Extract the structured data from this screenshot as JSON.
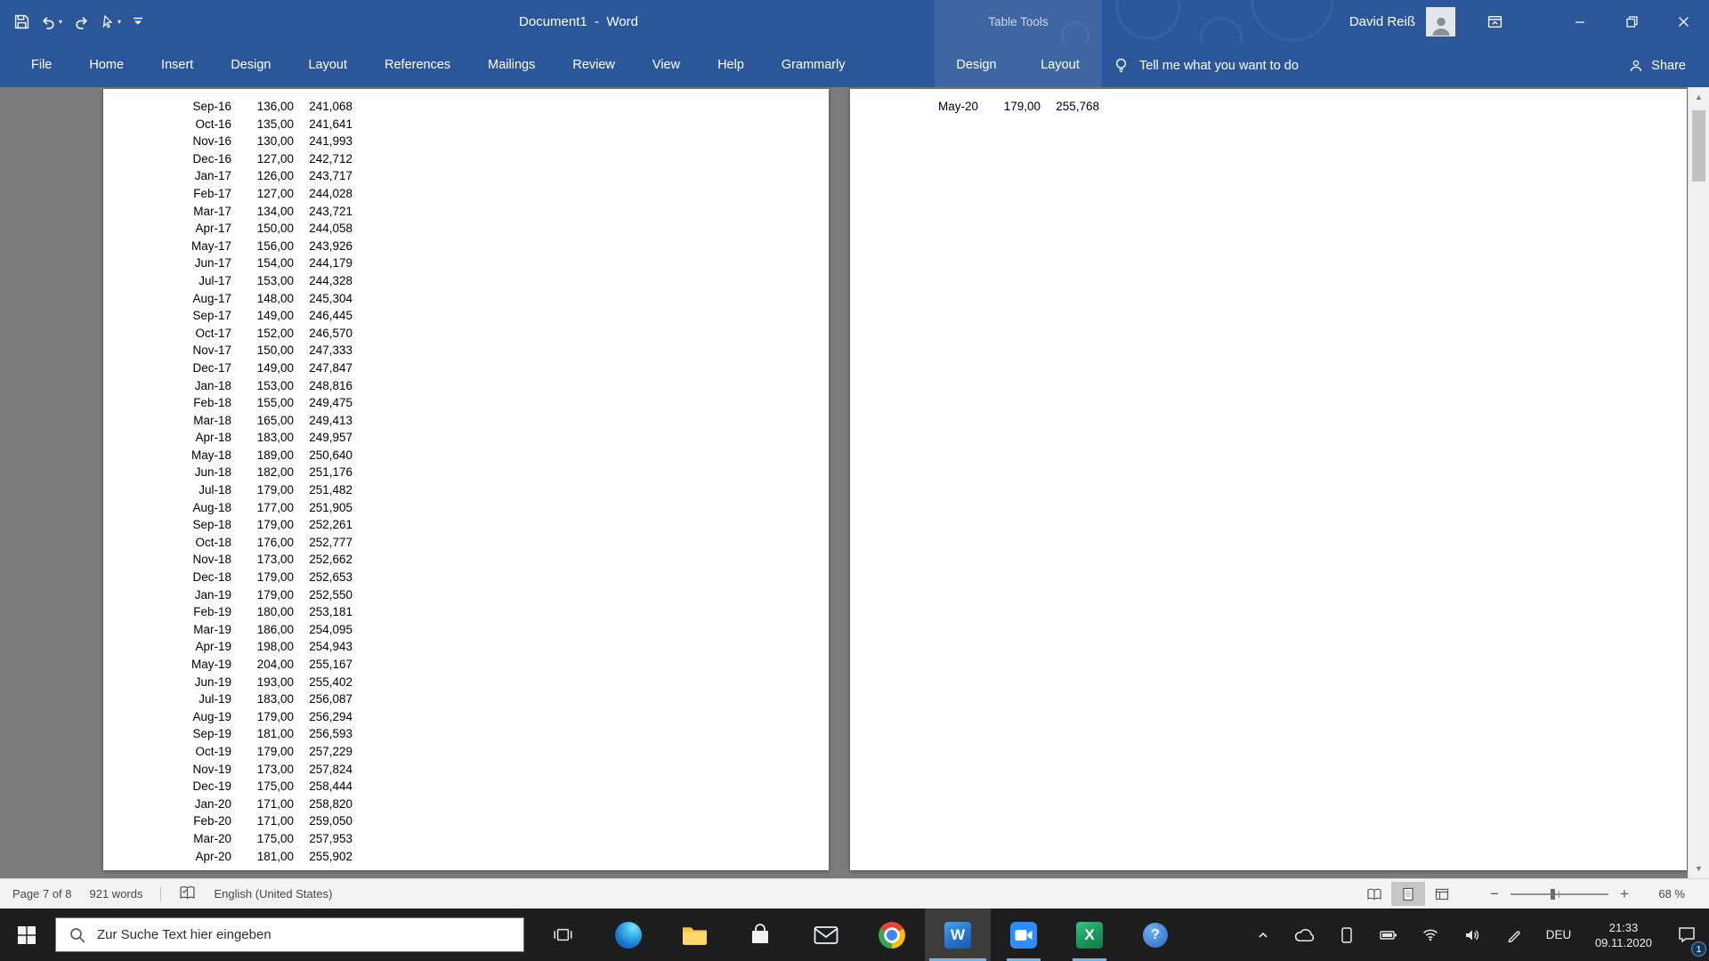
{
  "colors": {
    "accent_blue": "#2b579a",
    "taskbar_bg": "#1d1d1d",
    "doc_backdrop": "#7b7b7b",
    "page_bg": "#ffffff",
    "running_indicator": "#75b6e8"
  },
  "title_bar": {
    "title": "Document1  -  Word",
    "context_group_label": "Table Tools",
    "user_name": "David Reiß",
    "quick_access_icons": [
      "save-icon",
      "undo-icon",
      "redo-icon",
      "touch-mode-icon",
      "customize-quick-access-icon"
    ],
    "window_control_icons": [
      "ribbon-display-options-icon",
      "minimize-icon",
      "maximize-restore-icon",
      "close-icon"
    ]
  },
  "ribbon": {
    "tabs": [
      "File",
      "Home",
      "Insert",
      "Design",
      "Layout",
      "References",
      "Mailings",
      "Review",
      "View",
      "Help",
      "Grammarly"
    ],
    "contextual_tabs": [
      "Design",
      "Layout"
    ],
    "tell_me_icon": "lightbulb-icon",
    "tell_me_label": "Tell me what you want to do",
    "share_icon": "person-icon",
    "share_label": "Share"
  },
  "document": {
    "left_page": {
      "rows": [
        [
          "Sep-16",
          "136,00",
          "241,068"
        ],
        [
          "Oct-16",
          "135,00",
          "241,641"
        ],
        [
          "Nov-16",
          "130,00",
          "241,993"
        ],
        [
          "Dec-16",
          "127,00",
          "242,712"
        ],
        [
          "Jan-17",
          "126,00",
          "243,717"
        ],
        [
          "Feb-17",
          "127,00",
          "244,028"
        ],
        [
          "Mar-17",
          "134,00",
          "243,721"
        ],
        [
          "Apr-17",
          "150,00",
          "244,058"
        ],
        [
          "May-17",
          "156,00",
          "243,926"
        ],
        [
          "Jun-17",
          "154,00",
          "244,179"
        ],
        [
          "Jul-17",
          "153,00",
          "244,328"
        ],
        [
          "Aug-17",
          "148,00",
          "245,304"
        ],
        [
          "Sep-17",
          "149,00",
          "246,445"
        ],
        [
          "Oct-17",
          "152,00",
          "246,570"
        ],
        [
          "Nov-17",
          "150,00",
          "247,333"
        ],
        [
          "Dec-17",
          "149,00",
          "247,847"
        ],
        [
          "Jan-18",
          "153,00",
          "248,816"
        ],
        [
          "Feb-18",
          "155,00",
          "249,475"
        ],
        [
          "Mar-18",
          "165,00",
          "249,413"
        ],
        [
          "Apr-18",
          "183,00",
          "249,957"
        ],
        [
          "May-18",
          "189,00",
          "250,640"
        ],
        [
          "Jun-18",
          "182,00",
          "251,176"
        ],
        [
          "Jul-18",
          "179,00",
          "251,482"
        ],
        [
          "Aug-18",
          "177,00",
          "251,905"
        ],
        [
          "Sep-18",
          "179,00",
          "252,261"
        ],
        [
          "Oct-18",
          "176,00",
          "252,777"
        ],
        [
          "Nov-18",
          "173,00",
          "252,662"
        ],
        [
          "Dec-18",
          "179,00",
          "252,653"
        ],
        [
          "Jan-19",
          "179,00",
          "252,550"
        ],
        [
          "Feb-19",
          "180,00",
          "253,181"
        ],
        [
          "Mar-19",
          "186,00",
          "254,095"
        ],
        [
          "Apr-19",
          "198,00",
          "254,943"
        ],
        [
          "May-19",
          "204,00",
          "255,167"
        ],
        [
          "Jun-19",
          "193,00",
          "255,402"
        ],
        [
          "Jul-19",
          "183,00",
          "256,087"
        ],
        [
          "Aug-19",
          "179,00",
          "256,294"
        ],
        [
          "Sep-19",
          "181,00",
          "256,593"
        ],
        [
          "Oct-19",
          "179,00",
          "257,229"
        ],
        [
          "Nov-19",
          "173,00",
          "257,824"
        ],
        [
          "Dec-19",
          "175,00",
          "258,444"
        ],
        [
          "Jan-20",
          "171,00",
          "258,820"
        ],
        [
          "Feb-20",
          "171,00",
          "259,050"
        ],
        [
          "Mar-20",
          "175,00",
          "257,953"
        ],
        [
          "Apr-20",
          "181,00",
          "255,902"
        ]
      ]
    },
    "right_page": {
      "rows": [
        [
          "May-20",
          "179,00",
          "255,768"
        ]
      ]
    }
  },
  "status_bar": {
    "page_info": "Page 7 of 8",
    "word_count": "921 words",
    "proofing_icon": "proofing-book-icon",
    "language": "English (United States)",
    "view_icons": [
      "read-mode-icon",
      "print-layout-icon",
      "web-layout-icon"
    ],
    "selected_view": "print-layout-icon",
    "zoom_level": "68 %",
    "zoom_percent": 68
  },
  "taskbar": {
    "start_icon": "windows-start-icon",
    "search_icon": "magnifier-icon",
    "search_placeholder": "Zur Suche Text hier eingeben",
    "apps": [
      {
        "icon": "task-view-icon",
        "state": "none"
      },
      {
        "icon": "edge-icon",
        "state": "none"
      },
      {
        "icon": "file-explorer-icon",
        "state": "none"
      },
      {
        "icon": "store-icon",
        "state": "none"
      },
      {
        "icon": "mail-icon",
        "state": "none"
      },
      {
        "icon": "chrome-icon",
        "state": "none"
      },
      {
        "icon": "word-icon",
        "state": "active"
      },
      {
        "icon": "video-call-icon",
        "state": "running"
      },
      {
        "icon": "excel-icon",
        "state": "running"
      },
      {
        "icon": "help-icon",
        "state": "none"
      }
    ],
    "tray": {
      "icons": [
        "hidden-icons-chevron-icon",
        "onedrive-icon",
        "phone-icon",
        "battery-icon",
        "network-icon",
        "volume-icon",
        "pen-icon"
      ],
      "language": "DEU",
      "time": "21:33",
      "date": "09.11.2020",
      "notification_icon": "action-center-icon",
      "notification_badge": "1"
    }
  }
}
